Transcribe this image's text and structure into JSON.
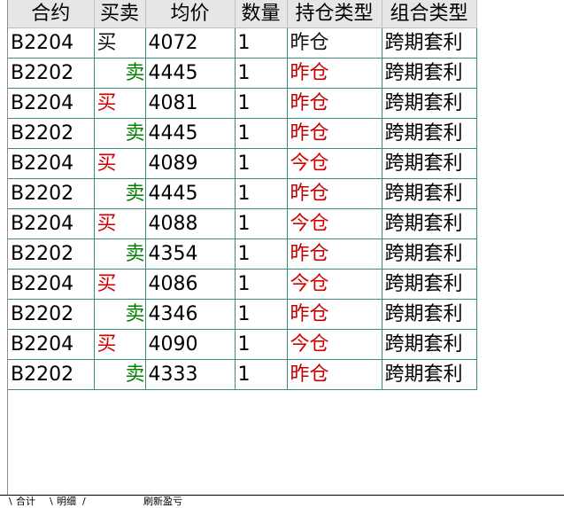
{
  "columns": [
    "合约",
    "买卖",
    "均价",
    "数量",
    "持仓类型",
    "组合类型"
  ],
  "rows": [
    {
      "contract": "B2204",
      "side": "买",
      "price": "4072",
      "qty": "1",
      "pos": "昨仓",
      "combo": "跨期套利",
      "side_color": "#111111",
      "pos_color": "#111111"
    },
    {
      "contract": "B2202",
      "side": "卖",
      "price": "4445",
      "qty": "1",
      "pos": "昨仓",
      "combo": "跨期套利",
      "side_color": "#008000",
      "pos_color": "#c00000"
    },
    {
      "contract": "B2204",
      "side": "买",
      "price": "4081",
      "qty": "1",
      "pos": "昨仓",
      "combo": "跨期套利",
      "side_color": "#d40000",
      "pos_color": "#c00000"
    },
    {
      "contract": "B2202",
      "side": "卖",
      "price": "4445",
      "qty": "1",
      "pos": "昨仓",
      "combo": "跨期套利",
      "side_color": "#008000",
      "pos_color": "#c00000"
    },
    {
      "contract": "B2204",
      "side": "买",
      "price": "4089",
      "qty": "1",
      "pos": "今仓",
      "combo": "跨期套利",
      "side_color": "#d40000",
      "pos_color": "#d40000"
    },
    {
      "contract": "B2202",
      "side": "卖",
      "price": "4445",
      "qty": "1",
      "pos": "昨仓",
      "combo": "跨期套利",
      "side_color": "#008000",
      "pos_color": "#c00000"
    },
    {
      "contract": "B2204",
      "side": "买",
      "price": "4088",
      "qty": "1",
      "pos": "今仓",
      "combo": "跨期套利",
      "side_color": "#d40000",
      "pos_color": "#d40000"
    },
    {
      "contract": "B2202",
      "side": "卖",
      "price": "4354",
      "qty": "1",
      "pos": "昨仓",
      "combo": "跨期套利",
      "side_color": "#008000",
      "pos_color": "#c00000"
    },
    {
      "contract": "B2204",
      "side": "买",
      "price": "4086",
      "qty": "1",
      "pos": "今仓",
      "combo": "跨期套利",
      "side_color": "#d40000",
      "pos_color": "#d40000"
    },
    {
      "contract": "B2202",
      "side": "卖",
      "price": "4346",
      "qty": "1",
      "pos": "昨仓",
      "combo": "跨期套利",
      "side_color": "#008000",
      "pos_color": "#c00000"
    },
    {
      "contract": "B2204",
      "side": "买",
      "price": "4090",
      "qty": "1",
      "pos": "今仓",
      "combo": "跨期套利",
      "side_color": "#d40000",
      "pos_color": "#d40000"
    },
    {
      "contract": "B2202",
      "side": "卖",
      "price": "4333",
      "qty": "1",
      "pos": "昨仓",
      "combo": "跨期套利",
      "side_color": "#008000",
      "pos_color": "#c00000"
    }
  ],
  "tabs": {
    "summary": "合计",
    "detail": "明细",
    "refresh": "刷新盈亏"
  }
}
